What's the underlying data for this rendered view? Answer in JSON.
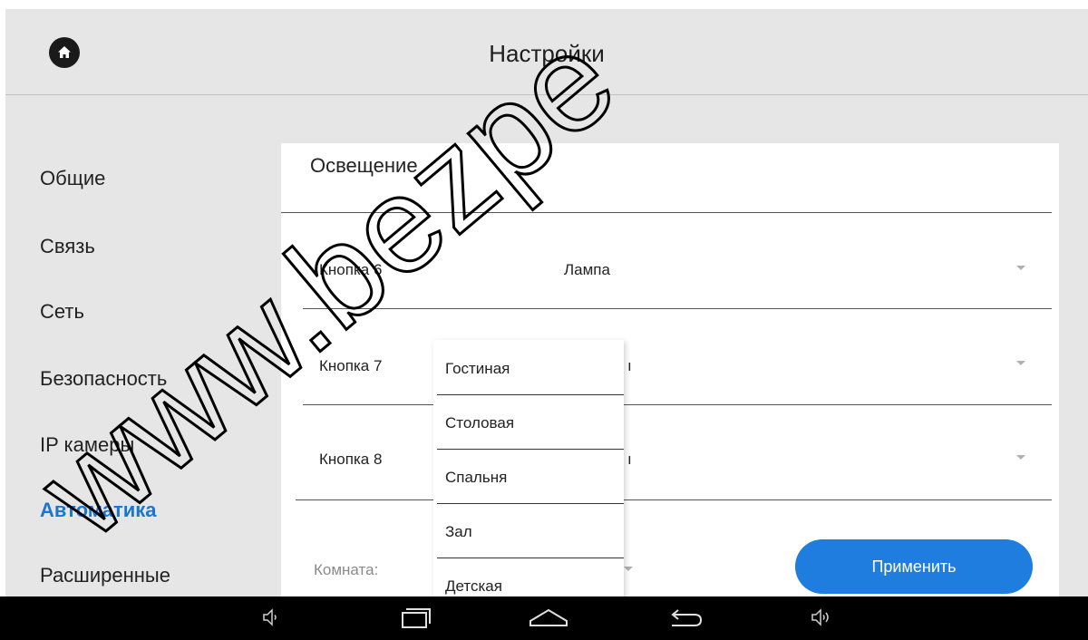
{
  "header": {
    "title": "Настройки",
    "home_icon": "home-icon"
  },
  "sidebar": {
    "items": [
      {
        "label": "Общие"
      },
      {
        "label": "Связь"
      },
      {
        "label": "Сеть"
      },
      {
        "label": "Безопасность"
      },
      {
        "label": "IP камеры"
      },
      {
        "label": "Автоматика",
        "active": true
      },
      {
        "label": "Расширенные"
      }
    ],
    "active_color": "#1976d2"
  },
  "panel": {
    "title": "Освещение",
    "rows": [
      {
        "label": "Кнопка 6",
        "value": "Лампа"
      },
      {
        "label": "Кнопка 7",
        "value": "ı"
      },
      {
        "label": "Кнопка 8",
        "value": "ı"
      }
    ],
    "room_label": "Комната:",
    "apply_label": "Применить",
    "apply_color": "#1f7de0"
  },
  "dropdown": {
    "options": [
      "Гостиная",
      "Столовая",
      "Спальня",
      "Зал",
      "Детская"
    ]
  },
  "watermark": {
    "text": "www.bezpe"
  },
  "navbar": {
    "buttons": [
      "volume-down-icon",
      "recent-apps-icon",
      "home-nav-icon",
      "back-icon",
      "volume-up-icon"
    ]
  }
}
